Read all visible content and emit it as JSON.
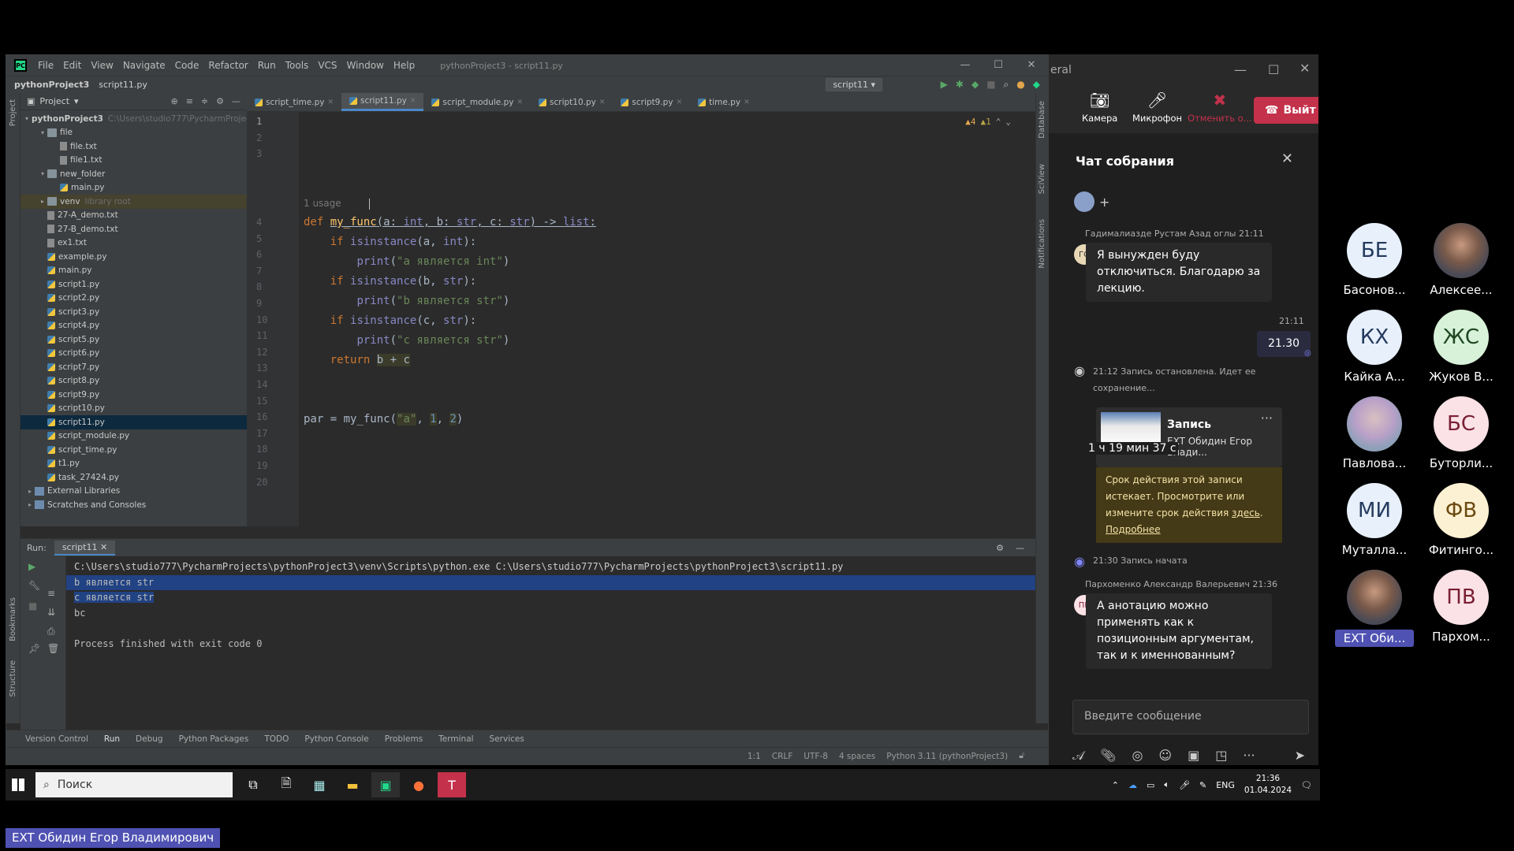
{
  "ide": {
    "app_label": "PC",
    "menu": [
      "File",
      "Edit",
      "View",
      "Navigate",
      "Code",
      "Refactor",
      "Run",
      "Tools",
      "VCS",
      "Window",
      "Help"
    ],
    "window_title": "pythonProject3 - script11.py",
    "breadcrumb": [
      "pythonProject3",
      "script11.py"
    ],
    "run_config": "script11",
    "project_label": "Project",
    "tree": [
      {
        "label": "pythonProject3",
        "extra": "C:\\Users\\studio777\\PycharmProject",
        "indent": 0,
        "type": "folder",
        "arrow": "▾"
      },
      {
        "label": "file",
        "indent": 1,
        "type": "folder",
        "arrow": "▾"
      },
      {
        "label": "file.txt",
        "indent": 2,
        "type": "file"
      },
      {
        "label": "file1.txt",
        "indent": 2,
        "type": "file"
      },
      {
        "label": "new_folder",
        "indent": 1,
        "type": "folder",
        "arrow": "▾"
      },
      {
        "label": "main.py",
        "indent": 2,
        "type": "py"
      },
      {
        "label": "venv",
        "extra": "library root",
        "indent": 1,
        "type": "folder",
        "arrow": "▸",
        "hl": true
      },
      {
        "label": "27-A_demo.txt",
        "indent": 1,
        "type": "file"
      },
      {
        "label": "27-B_demo.txt",
        "indent": 1,
        "type": "file"
      },
      {
        "label": "ex1.txt",
        "indent": 1,
        "type": "file"
      },
      {
        "label": "example.py",
        "indent": 1,
        "type": "py"
      },
      {
        "label": "main.py",
        "indent": 1,
        "type": "py"
      },
      {
        "label": "script1.py",
        "indent": 1,
        "type": "py"
      },
      {
        "label": "script2.py",
        "indent": 1,
        "type": "py"
      },
      {
        "label": "script3.py",
        "indent": 1,
        "type": "py"
      },
      {
        "label": "script4.py",
        "indent": 1,
        "type": "py"
      },
      {
        "label": "script5.py",
        "indent": 1,
        "type": "py"
      },
      {
        "label": "script6.py",
        "indent": 1,
        "type": "py"
      },
      {
        "label": "script7.py",
        "indent": 1,
        "type": "py"
      },
      {
        "label": "script8.py",
        "indent": 1,
        "type": "py"
      },
      {
        "label": "script9.py",
        "indent": 1,
        "type": "py"
      },
      {
        "label": "script10.py",
        "indent": 1,
        "type": "py"
      },
      {
        "label": "script11.py",
        "indent": 1,
        "type": "py",
        "sel": true
      },
      {
        "label": "script_module.py",
        "indent": 1,
        "type": "py"
      },
      {
        "label": "script_time.py",
        "indent": 1,
        "type": "py"
      },
      {
        "label": "t1.py",
        "indent": 1,
        "type": "py"
      },
      {
        "label": "task_27424.py",
        "indent": 1,
        "type": "py"
      },
      {
        "label": "External Libraries",
        "indent": 0,
        "type": "lib",
        "arrow": "▸"
      },
      {
        "label": "Scratches and Consoles",
        "indent": 0,
        "type": "lib",
        "arrow": "▸"
      }
    ],
    "tabs": [
      {
        "label": "script_time.py"
      },
      {
        "label": "script11.py",
        "active": true
      },
      {
        "label": "script_module.py"
      },
      {
        "label": "script10.py"
      },
      {
        "label": "script9.py"
      },
      {
        "label": "time.py"
      }
    ],
    "warnings": "▲4",
    "weak_warnings": "▲1",
    "line_numbers": [
      "1",
      "2",
      "3",
      "4",
      "5",
      "6",
      "7",
      "8",
      "9",
      "10",
      "11",
      "12",
      "13",
      "14",
      "15",
      "16",
      "17",
      "18",
      "19",
      "20"
    ],
    "usage_hint": "1 usage",
    "run_label": "Run:",
    "run_tab": "script11",
    "console": {
      "command": "C:\\Users\\studio777\\PycharmProjects\\pythonProject3\\venv\\Scripts\\python.exe C:\\Users\\studio777\\PycharmProjects\\pythonProject3\\script11.py",
      "out1": "b является str",
      "out2": "c является str",
      "out3": "bc",
      "exit": "Process finished with exit code 0"
    },
    "bottom_tools": [
      "Version Control",
      "Run",
      "Debug",
      "Python Packages",
      "TODO",
      "Python Console",
      "Problems",
      "Terminal",
      "Services"
    ],
    "status": [
      "1:1",
      "CRLF",
      "UTF-8",
      "4 spaces",
      "Python 3.11 (pythonProject3)"
    ],
    "side_labels": {
      "project": "Project",
      "bookmarks": "Bookmarks",
      "structure": "Structure",
      "database": "Database",
      "sciview": "SciView",
      "notifications": "Notifications"
    }
  },
  "teams": {
    "top_title": "eral",
    "camera": "Камера",
    "mic": "Микрофон",
    "share": "Отменить о...",
    "leave": "Выйт",
    "chat_title": "Чат собрания",
    "messages": {
      "m1_author": "Гадималиазде Рустам Азад оглы  21:11",
      "m1_avatar": "ГО",
      "m1_text": "Я вынужден буду отключиться. Благодарю за лекцию.",
      "m2_time": "21:11",
      "m2_text": "21.30",
      "rec_stop": "21:12   Запись остановлена. Идет ее сохранение...",
      "rec_title": "Запись",
      "rec_sub": "EXT Обидин Егор Влади...",
      "rec_duration": "1 ч 19 мин 37 с",
      "notice": "Срок действия этой записи истекает. Просмотрите или измените срок действия",
      "notice_link1": "здесь",
      "notice_link2": "Подробнее",
      "rec_start": "21:30   Запись начата",
      "m3_author": "Пархоменко Александр Валерьевич  21:36",
      "m3_avatar": "ПВ",
      "m3_text": "А анотацию можно применять как к позиционным аргументам, так и к именнованным?"
    },
    "input_placeholder": "Введите сообщение"
  },
  "participants": [
    {
      "initials": "БЕ",
      "name": "Басонов...",
      "color": "blue"
    },
    {
      "initials": "",
      "name": "Алексее...",
      "color": "photo"
    },
    {
      "initials": "КХ",
      "name": "Кайка А...",
      "color": "blue"
    },
    {
      "initials": "ЖС",
      "name": "Жуков В...",
      "color": "green"
    },
    {
      "initials": "",
      "name": "Павлова...",
      "color": "photo2"
    },
    {
      "initials": "БС",
      "name": "Буторли...",
      "color": "pink"
    },
    {
      "initials": "МИ",
      "name": "Муталла...",
      "color": "blue"
    },
    {
      "initials": "ФВ",
      "name": "Фитинго...",
      "color": "cream"
    },
    {
      "initials": "",
      "name": "EXT Оби...",
      "color": "photo",
      "hl": true
    },
    {
      "initials": "ПВ",
      "name": "Пархом...",
      "color": "pink"
    }
  ],
  "taskbar": {
    "search": "Поиск",
    "lang": "ENG",
    "time": "21:36",
    "date": "01.04.2024"
  },
  "speaker_label": "EXT Обидин Егор Владимирович"
}
